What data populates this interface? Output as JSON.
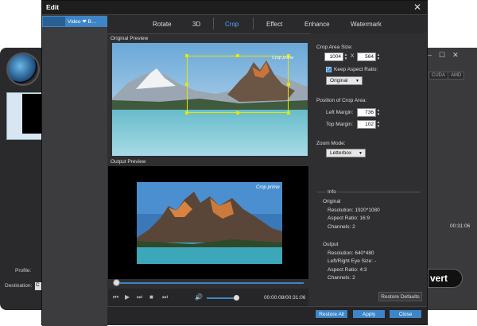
{
  "dialog": {
    "title": "Edit"
  },
  "left": {
    "item": "Video ❤ B…"
  },
  "tabs": [
    "Rotate",
    "3D",
    "Crop",
    "Effect",
    "Enhance",
    "Watermark"
  ],
  "preview": {
    "original_label": "Original Preview",
    "output_label": "Output Preview",
    "watermark_text": "Crop prime"
  },
  "crop": {
    "section_label": "Crop Area Size:",
    "width": "1004",
    "x_sep": "X",
    "height": "564",
    "keep_ratio_label": "Keep Aspect Ratio:",
    "ratio_value": "Original",
    "position_label": "Position of Crop Area:",
    "left_margin_label": "Left Margin:",
    "left_margin": "736",
    "top_margin_label": "Top Margin:",
    "top_margin": "102",
    "zoom_label": "Zoom Mode:",
    "zoom_value": "Letterbox"
  },
  "info": {
    "title": "Info",
    "original": "Original",
    "resolution": "Resolution: 1920*1080",
    "aspect": "Aspect Ratio: 16:9",
    "channels": "Channels: 2",
    "output": "Output",
    "out_resolution": "Resolution: 640*480",
    "lr_eye": "Left/Right Eye Size: -",
    "out_aspect": "Aspect Ratio: 4:3",
    "out_channels": "Channels: 2"
  },
  "player": {
    "timecode": "00:00:08/00:31:06"
  },
  "buttons": {
    "restore_defaults": "Restore Defaults",
    "restore_all": "Restore All",
    "apply": "Apply",
    "close": "Close"
  },
  "background": {
    "cuda": "CUDA",
    "amd": "AMD",
    "convert": "vert",
    "time": "00:31:06",
    "profile": "Profile:",
    "destination": "Destination:",
    "dest_value": "C"
  },
  "colors": {
    "accent": "#3d85c6",
    "crop_frame": "#e4e800"
  }
}
